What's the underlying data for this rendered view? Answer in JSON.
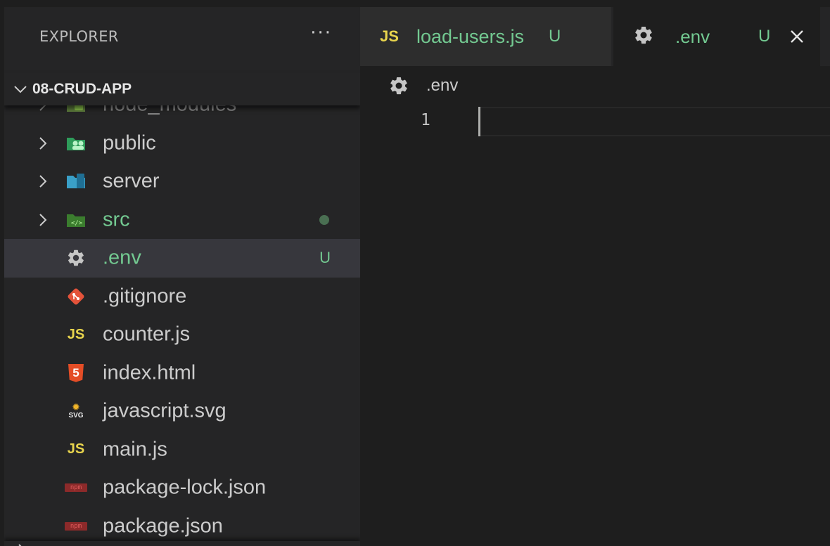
{
  "sidebar": {
    "title": "EXPLORER",
    "more_label": "···",
    "project": "08-CRUD-APP",
    "items": [
      {
        "label": "node_modules",
        "kind": "folder",
        "icon": "node-folder-icon"
      },
      {
        "label": "public",
        "kind": "folder",
        "icon": "public-folder-icon"
      },
      {
        "label": "server",
        "kind": "folder",
        "icon": "server-folder-icon"
      },
      {
        "label": "src",
        "kind": "folder",
        "icon": "src-folder-icon",
        "status": "modified-dot"
      },
      {
        "label": ".env",
        "kind": "file",
        "icon": "gear-icon",
        "badge": "U",
        "selected": true
      },
      {
        "label": ".gitignore",
        "kind": "file",
        "icon": "git-icon"
      },
      {
        "label": "counter.js",
        "kind": "file",
        "icon": "js-icon"
      },
      {
        "label": "index.html",
        "kind": "file",
        "icon": "html5-icon"
      },
      {
        "label": "javascript.svg",
        "kind": "file",
        "icon": "svg-icon"
      },
      {
        "label": "main.js",
        "kind": "file",
        "icon": "js-icon"
      },
      {
        "label": "package-lock.json",
        "kind": "file",
        "icon": "npm-icon"
      },
      {
        "label": "package.json",
        "kind": "file",
        "icon": "npm-icon"
      }
    ]
  },
  "tabs": [
    {
      "icon_text": "JS",
      "label": "load-users.js",
      "badge": "U",
      "active": false
    },
    {
      "label": ".env",
      "badge": "U",
      "active": true,
      "close": "✕"
    }
  ],
  "breadcrumb": {
    "label": ".env"
  },
  "editor": {
    "lines": [
      "1"
    ]
  },
  "colors": {
    "sidebar_bg": "#252526",
    "editor_bg": "#1e1e1e",
    "untracked_green": "#73c991",
    "js_yellow": "#e8d44d",
    "selection_bg": "#37373d"
  },
  "icons": {
    "js_text": "JS",
    "html_text": "5",
    "npm_text": "npm",
    "svg_text": "SVG"
  }
}
